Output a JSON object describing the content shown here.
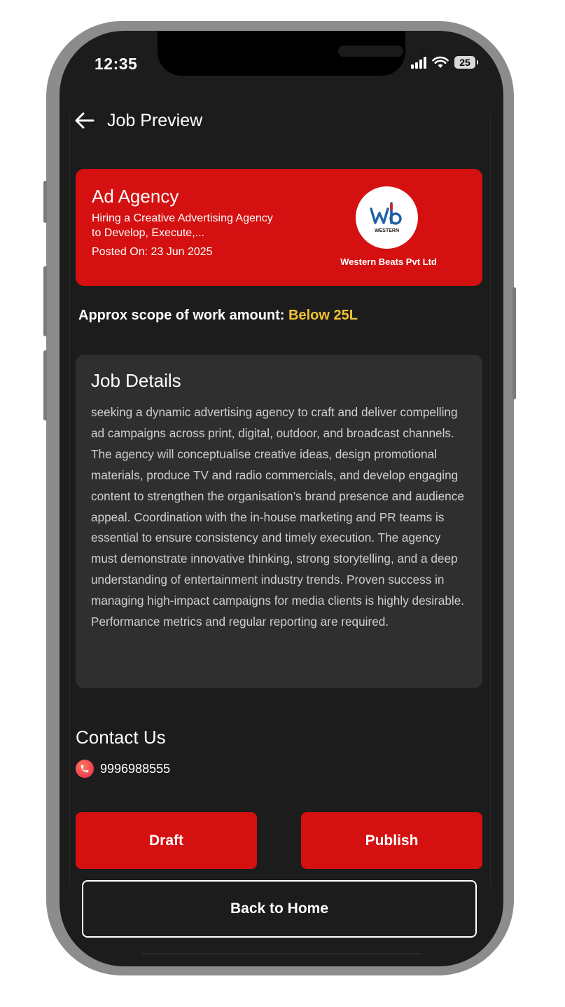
{
  "status_bar": {
    "time": "12:35",
    "battery": "25"
  },
  "header": {
    "title": "Job Preview",
    "back_icon": "arrow-left-icon"
  },
  "job_card": {
    "title": "Ad Agency",
    "subtitle": "Hiring a Creative Advertising Agency to Develop, Execute,...",
    "posted": "Posted On: 23 Jun 2025",
    "company_name": "Western Beats Pvt Ltd",
    "logo_text": "wb",
    "logo_subtext": "WESTERN",
    "color": "#d41010"
  },
  "scope": {
    "label": "Approx scope of work amount:",
    "value": "Below 25L",
    "value_color": "#f2c230"
  },
  "details": {
    "title": "Job Details",
    "body": "seeking a dynamic advertising agency to craft and deliver compelling ad campaigns across print, digital, outdoor, and broadcast channels. The agency will conceptualise creative ideas, design promotional materials, produce TV and radio commercials, and develop engaging content to strengthen the organisation’s brand presence and audience appeal. Coordination with the in-house marketing and PR teams is essential to ensure consistency and timely execution. The agency must demonstrate innovative thinking, strong storytelling, and a deep understanding of entertainment industry trends. Proven success in managing high-impact campaigns for media clients is highly desirable. Performance metrics and regular reporting are required."
  },
  "contact": {
    "title": "Contact Us",
    "phone": "9996988555",
    "phone_icon": "phone-icon"
  },
  "buttons": {
    "draft": "Draft",
    "publish": "Publish",
    "home": "Back to Home"
  }
}
